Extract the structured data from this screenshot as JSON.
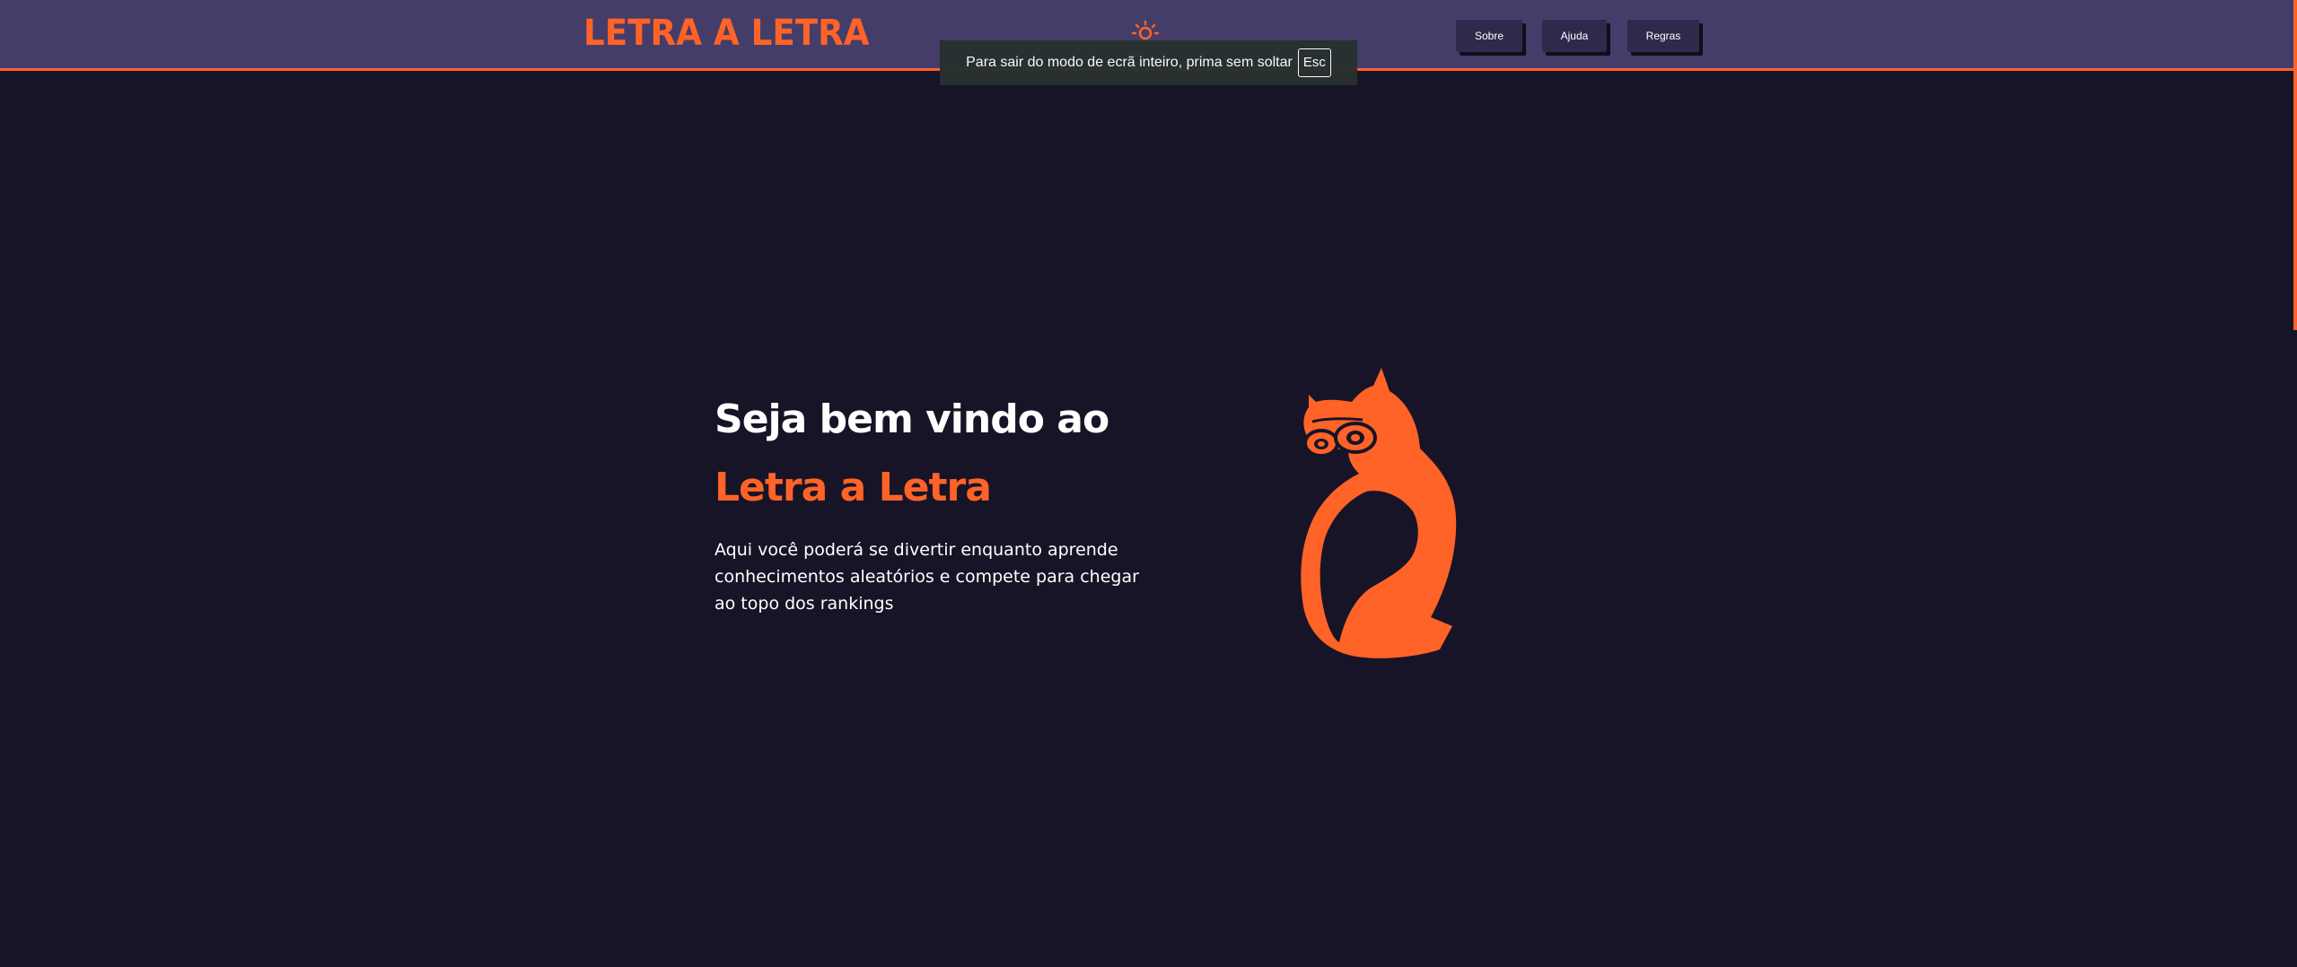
{
  "header": {
    "logo": "LETRA A LETRA",
    "theme_toggle_icon": "sun-icon",
    "nav": {
      "sobre": "Sobre",
      "ajuda": "Ajuda",
      "regras": "Regras"
    }
  },
  "fullscreen_notice": {
    "text": "Para sair do modo de ecrã inteiro, prima sem soltar",
    "key": "Esc"
  },
  "hero": {
    "line1": "Seja bem vindo ao",
    "line2": "Letra a Letra",
    "description": "Aqui você poderá se divertir enquanto aprende conhecimentos aleatórios e compete para chegar ao topo dos rankings",
    "illustration_icon": "owl-icon"
  },
  "colors": {
    "accent": "#ff6327",
    "header_bg": "#443d69",
    "page_bg": "#181427",
    "button_bg": "#2f2a4b"
  }
}
